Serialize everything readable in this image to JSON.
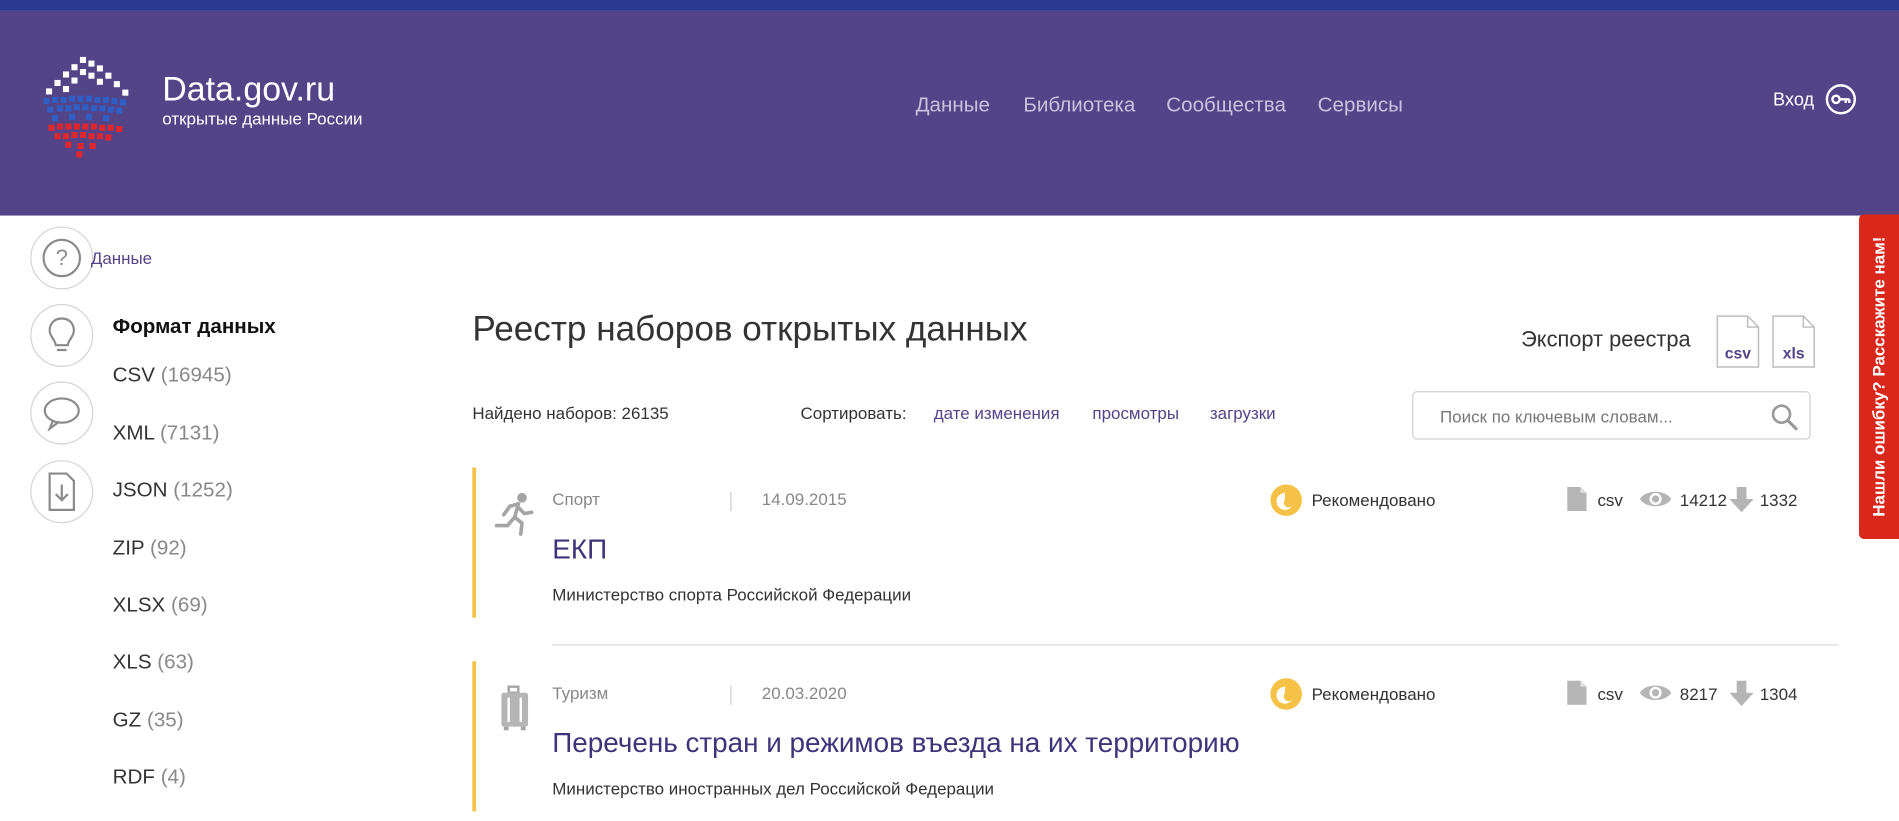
{
  "header": {
    "title": "Data.gov.ru",
    "subtitle": "открытые данные России",
    "nav": [
      "Данные",
      "Библиотека",
      "Сообщества",
      "Сервисы"
    ],
    "login_label": "Вход"
  },
  "breadcrumb": "Данные",
  "sidebar": {
    "heading": "Формат данных",
    "formats": [
      {
        "label": "CSV",
        "count": "(16945)"
      },
      {
        "label": "XML",
        "count": "(7131)"
      },
      {
        "label": "JSON",
        "count": "(1252)"
      },
      {
        "label": "ZIP",
        "count": "(92)"
      },
      {
        "label": "XLSX",
        "count": "(69)"
      },
      {
        "label": "XLS",
        "count": "(63)"
      },
      {
        "label": "GZ",
        "count": "(35)"
      },
      {
        "label": "RDF",
        "count": "(4)"
      }
    ]
  },
  "main": {
    "title": "Реестр наборов открытых данных",
    "export_label": "Экспорт реестра",
    "export_formats": [
      "csv",
      "xls"
    ],
    "found": "Найдено наборов: 26135",
    "sort_label": "Сортировать:",
    "sort_options": [
      "дате изменения",
      "просмотры",
      "загрузки"
    ],
    "search_placeholder": "Поиск по ключевым словам..."
  },
  "datasets": [
    {
      "topic": "Спорт",
      "topic_icon": "running-person-icon",
      "date": "14.09.2015",
      "badge": "Рекомендовано",
      "format": "csv",
      "views": "14212",
      "downloads": "1332",
      "title": "ЕКП",
      "organization": "Министерство спорта Российской Федерации"
    },
    {
      "topic": "Туризм",
      "topic_icon": "suitcase-icon",
      "date": "20.03.2020",
      "badge": "Рекомендовано",
      "format": "csv",
      "views": "8217",
      "downloads": "1304",
      "title": "Перечень стран и режимов въезда на их территорию",
      "organization": "Министерство иностранных дел Российской Федерации"
    }
  ],
  "feedback_tab": "Нашли ошибку? Расскажите нам!",
  "colors": {
    "header_bg": "#534488",
    "accent_bar": "#f5c146",
    "link": "#534488",
    "feedback_bg": "#d9271c"
  }
}
